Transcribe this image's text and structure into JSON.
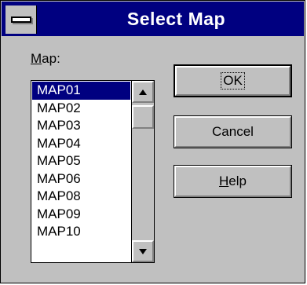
{
  "dialog": {
    "title": "Select Map",
    "map_label": "Map:",
    "map_label_mnemonic": "M",
    "map_label_rest": "ap:"
  },
  "list": {
    "selected": "MAP01",
    "items": [
      "MAP01",
      "MAP02",
      "MAP03",
      "MAP04",
      "MAP05",
      "MAP06",
      "MAP08",
      "MAP09",
      "MAP10"
    ]
  },
  "buttons": {
    "ok": "OK",
    "cancel": "Cancel",
    "help": "Help",
    "help_mnemonic": "H",
    "help_rest": "elp"
  },
  "colors": {
    "titlebar": "#000080",
    "face": "#c0c0c0",
    "selection": "#000080"
  },
  "icons": {
    "system_menu": "system-menu-icon",
    "scroll_up": "up-arrow-icon",
    "scroll_down": "down-arrow-icon"
  }
}
